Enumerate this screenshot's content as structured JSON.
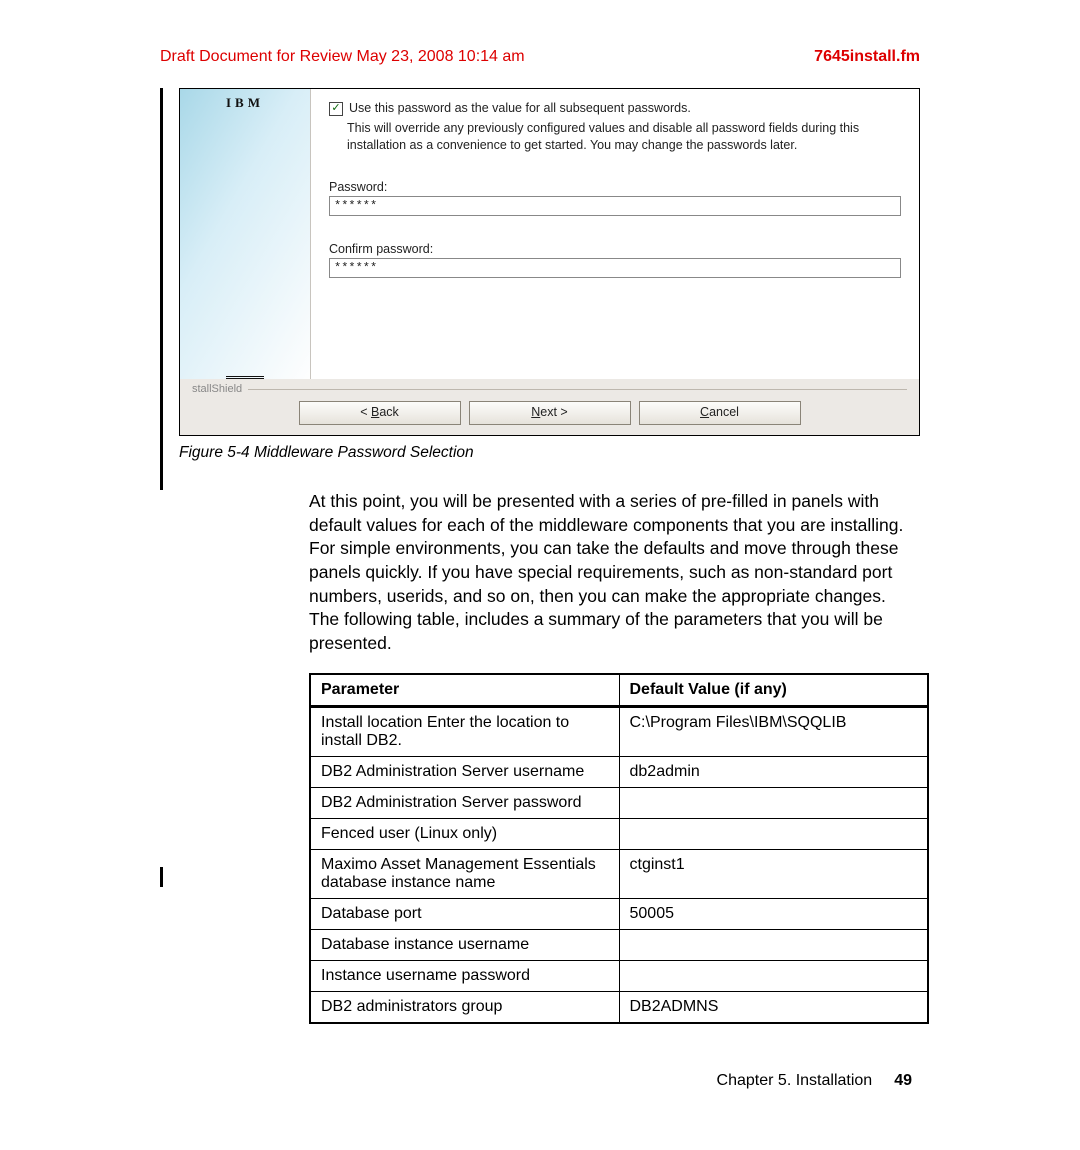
{
  "header": {
    "left": "Draft Document for Review May 23, 2008 10:14 am",
    "right": "7645install.fm"
  },
  "installer": {
    "logo": "IBM",
    "checkbox_label": "Use this password as the value for all subsequent passwords.",
    "description": "This will override any previously configured values and disable all password fields during this installation as a convenience to get started. You may change the passwords later.",
    "password_label": "Password:",
    "password_value": "******",
    "confirm_label": "Confirm password:",
    "confirm_value": "******",
    "installshield": "stallShield",
    "buttons": {
      "back": "< Back",
      "next": "Next >",
      "cancel": "Cancel"
    }
  },
  "figure_caption": "Figure 5-4   Middleware Password Selection",
  "body_text": "At this point, you will be presented with a series of pre-filled in panels with default values for each of the middleware components that you are installing. For simple environments, you can take the defaults and move through these panels quickly. If you have special requirements, such as non-standard port numbers, userids, and so on, then you can make the appropriate changes. The following table, includes a summary of the parameters that you will be presented.",
  "table": {
    "headers": [
      "Parameter",
      "Default Value (if any)"
    ],
    "rows": [
      [
        "Install location Enter the location to install DB2.",
        "C:\\Program Files\\IBM\\SQQLIB"
      ],
      [
        "DB2 Administration Server username",
        "db2admin"
      ],
      [
        "DB2 Administration Server password",
        ""
      ],
      [
        "Fenced user (Linux only)",
        ""
      ],
      [
        "Maximo Asset Management Essentials database instance name",
        "ctginst1"
      ],
      [
        "Database port",
        "50005"
      ],
      [
        "Database instance username",
        ""
      ],
      [
        "Instance username password",
        ""
      ],
      [
        "DB2 administrators group",
        "DB2ADMNS"
      ]
    ]
  },
  "footer": {
    "chapter": "Chapter 5. Installation",
    "page": "49"
  }
}
